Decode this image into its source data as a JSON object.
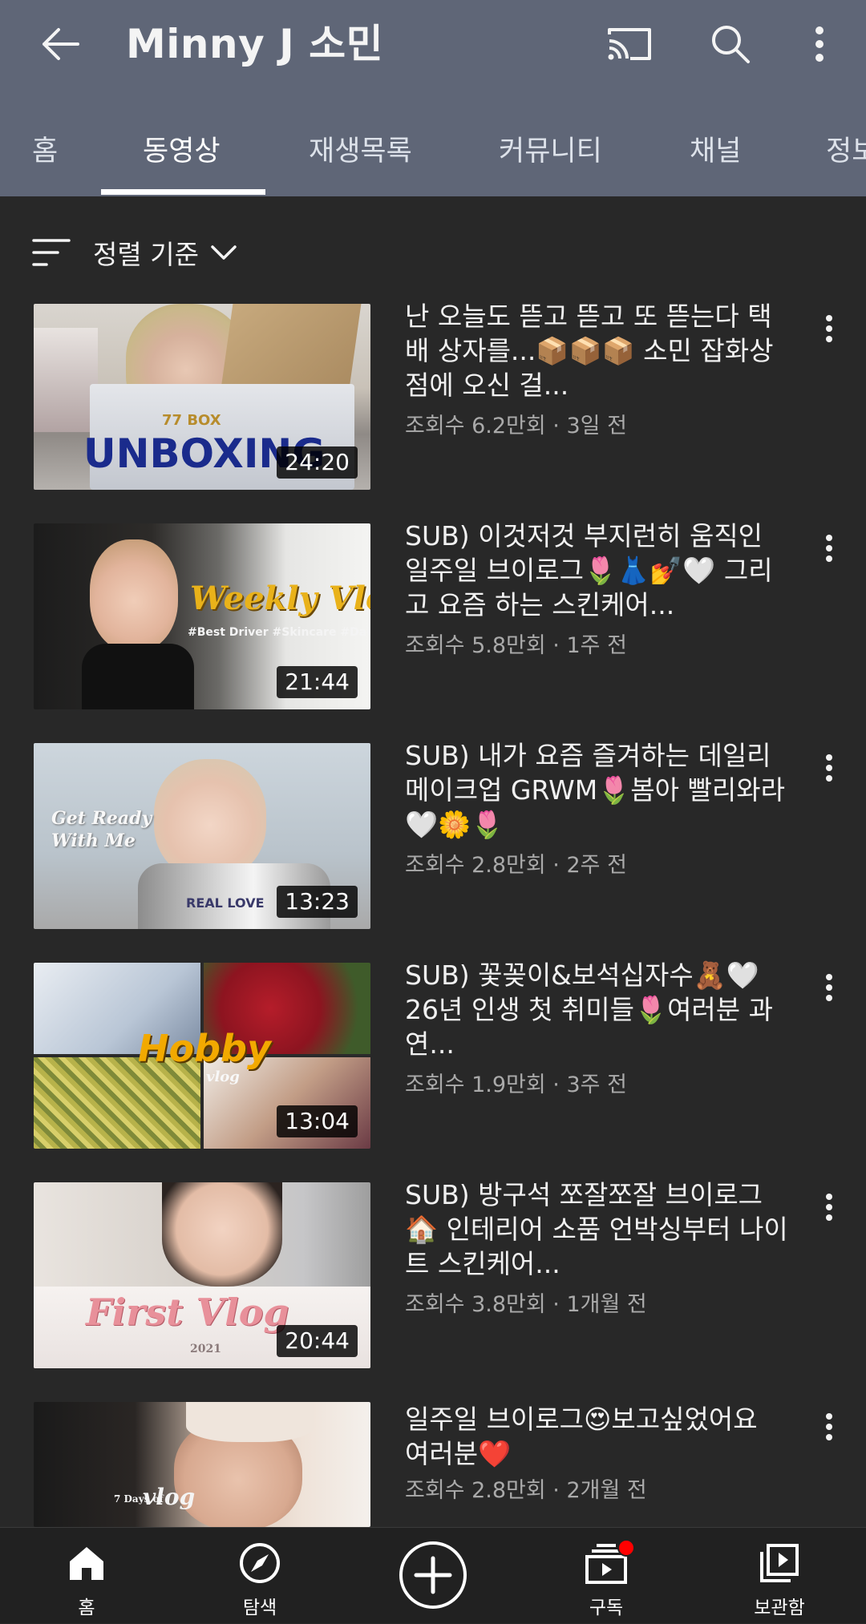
{
  "header": {
    "channel_title": "Minny J 소민",
    "icons": [
      "back-arrow-icon",
      "cast-icon",
      "search-icon",
      "more-vert-icon"
    ]
  },
  "tabs": [
    {
      "label": "홈",
      "active": false
    },
    {
      "label": "동영상",
      "active": true
    },
    {
      "label": "재생목록",
      "active": false
    },
    {
      "label": "커뮤니티",
      "active": false
    },
    {
      "label": "채널",
      "active": false
    },
    {
      "label": "정보",
      "active": false
    }
  ],
  "sort": {
    "label": "정렬 기준"
  },
  "videos": [
    {
      "title": "난 오늘도 뜯고 뜯고 또 뜯는다 택배 상자를...📦📦📦 소민 잡화상점에 오신 걸...",
      "meta": "조회수 6.2만회 · 3일 전",
      "duration": "24:20",
      "thumb_text": "UNBOXING",
      "thumb_subtext": "77 BOX"
    },
    {
      "title": "SUB) 이것저것 부지런히 움직인 일주일 브이로그🌷👗💅🤍 그리고 요즘 하는 스킨케어...",
      "meta": "조회수 5.8만회 · 1주 전",
      "duration": "21:44",
      "thumb_text": "Weekly Vlog",
      "thumb_subtext": "#Best Driver #Skincare #Daily"
    },
    {
      "title": "SUB) 내가 요즘 즐겨하는 데일리메이크업 GRWM🌷봄아 빨리와라🤍🌼🌷",
      "meta": "조회수 2.8만회 · 2주 전",
      "duration": "13:23",
      "thumb_text": "Get Ready With Me",
      "thumb_subtext": "REAL LOVE"
    },
    {
      "title": "SUB) 꽃꽂이&보석십자수🧸🤍26년 인생 첫 취미들🌷여러분 과연...",
      "meta": "조회수 1.9만회 · 3주 전",
      "duration": "13:04",
      "thumb_text": "Hobby",
      "thumb_subtext": "vlog"
    },
    {
      "title": "SUB) 방구석 쪼잘쪼잘 브이로그🏠 인테리어 소품 언박싱부터 나이트 스킨케어...",
      "meta": "조회수 3.8만회 · 1개월 전",
      "duration": "20:44",
      "thumb_text": "First Vlog",
      "thumb_subtext": "2021"
    },
    {
      "title": "일주일 브이로그😍보고싶었어요 여러분❤️",
      "meta": "조회수 2.8만회 · 2개월 전",
      "duration": "",
      "thumb_text": "vlog",
      "thumb_subtext": "7 Days of"
    }
  ],
  "bottom_nav": [
    {
      "label": "홈",
      "icon": "home-icon",
      "active": true
    },
    {
      "label": "탐색",
      "icon": "explore-compass-icon",
      "active": false
    },
    {
      "label": "",
      "icon": "create-plus-icon",
      "active": false
    },
    {
      "label": "구독",
      "icon": "subscriptions-icon",
      "active": false,
      "badge": true
    },
    {
      "label": "보관함",
      "icon": "library-icon",
      "active": false
    }
  ],
  "colors": {
    "header_bg": "#5f6677",
    "body_bg": "#282828",
    "nav_bg": "#212121",
    "badge": "#ff0000",
    "meta_text": "#aaaaaa"
  }
}
